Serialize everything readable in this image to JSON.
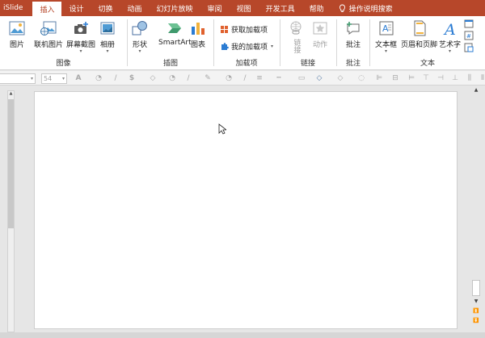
{
  "tabs": [
    {
      "label": "iSlide",
      "active": false
    },
    {
      "label": "插入",
      "active": true
    },
    {
      "label": "设计",
      "active": false
    },
    {
      "label": "切换",
      "active": false
    },
    {
      "label": "动画",
      "active": false
    },
    {
      "label": "幻灯片放映",
      "active": false
    },
    {
      "label": "审阅",
      "active": false
    },
    {
      "label": "视图",
      "active": false
    },
    {
      "label": "开发工具",
      "active": false
    },
    {
      "label": "帮助",
      "active": false
    }
  ],
  "tell_me": {
    "label": "操作说明搜索",
    "icon": "lightbulb-icon"
  },
  "ribbon": {
    "images": {
      "label": "图像",
      "picture": "图片",
      "online_picture": "联机图片",
      "screenshot": "屏幕截图",
      "album": "相册"
    },
    "illustrations": {
      "label": "插图",
      "shapes": "形状",
      "smartart": "SmartArt",
      "chart": "图表"
    },
    "addins": {
      "label": "加载项",
      "get_addins": "获取加载项",
      "my_addins": "我的加载项"
    },
    "links": {
      "label": "链接",
      "link": "链接",
      "action": "动作"
    },
    "comments": {
      "label": "批注",
      "comment": "批注"
    },
    "text": {
      "label": "文本",
      "textbox": "文本框",
      "header_footer": "页眉和页脚",
      "wordart": "艺术字"
    }
  },
  "format_bar": {
    "font_name": "",
    "font_size": "54"
  },
  "colors": {
    "accent": "#b7472a",
    "ribbon_bg": "#ffffff",
    "workspace_bg": "#e6e6e6"
  }
}
